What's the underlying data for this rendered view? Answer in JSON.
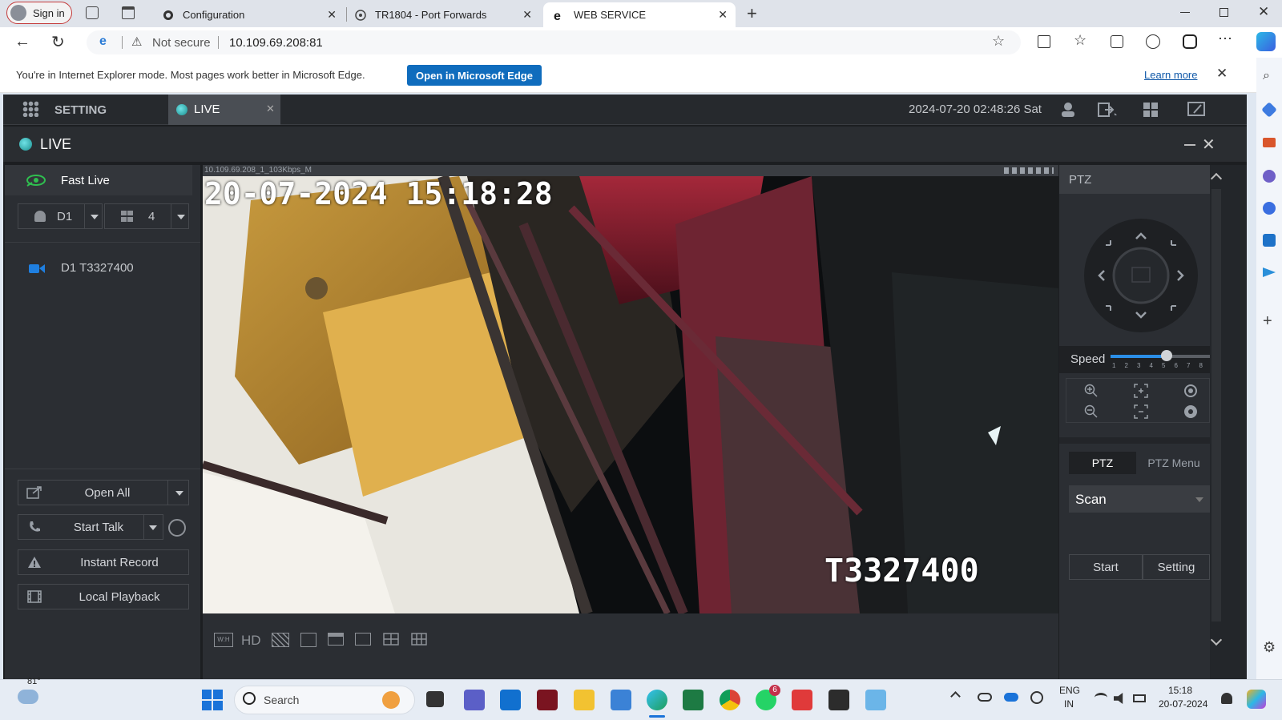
{
  "browser": {
    "profile_label": "Sign in",
    "tabs": [
      {
        "label": "Configuration"
      },
      {
        "label": "TR1804 - Port Forwards"
      },
      {
        "label": "WEB SERVICE"
      }
    ],
    "security_label": "Not secure",
    "url": "10.109.69.208:81",
    "ie_mode_message": "You're in Internet Explorer mode. Most pages work better in Microsoft Edge.",
    "open_edge_label": "Open in Microsoft Edge",
    "learn_more_label": "Learn more"
  },
  "app": {
    "setting_label": "SETTING",
    "live_tab_label": "LIVE",
    "datetime": "2024-07-20 02:48:26 Sat",
    "live_title": "LIVE",
    "fast_live_label": "Fast Live",
    "device_select": "D1",
    "split_select": "4",
    "channels": [
      {
        "label": "D1 T3327400"
      }
    ],
    "open_all_label": "Open All",
    "start_talk_label": "Start Talk",
    "instant_record_label": "Instant Record",
    "local_playback_label": "Local Playback"
  },
  "video": {
    "stream_info": "10.109.69.208_1_103Kbps_M",
    "osd_timestamp": "20-07-2024 15:18:28",
    "osd_camera_name": "T3327400",
    "toolbar": {
      "wh_label": "W:H",
      "hd_label": "HD"
    }
  },
  "ptz": {
    "title": "PTZ",
    "speed_label": "Speed",
    "speed_ticks": [
      "1",
      "2",
      "3",
      "4",
      "5",
      "6",
      "7",
      "8"
    ],
    "speed_value": 5,
    "tab_ptz": "PTZ",
    "tab_menu": "PTZ Menu",
    "mode_select": "Scan",
    "start_label": "Start",
    "setting_label": "Setting"
  },
  "taskbar": {
    "weather_temp": "81°",
    "search_placeholder": "Search",
    "lang_top": "ENG",
    "lang_bottom": "IN",
    "time": "15:18",
    "date": "20-07-2024",
    "whatsapp_badge": "6"
  }
}
